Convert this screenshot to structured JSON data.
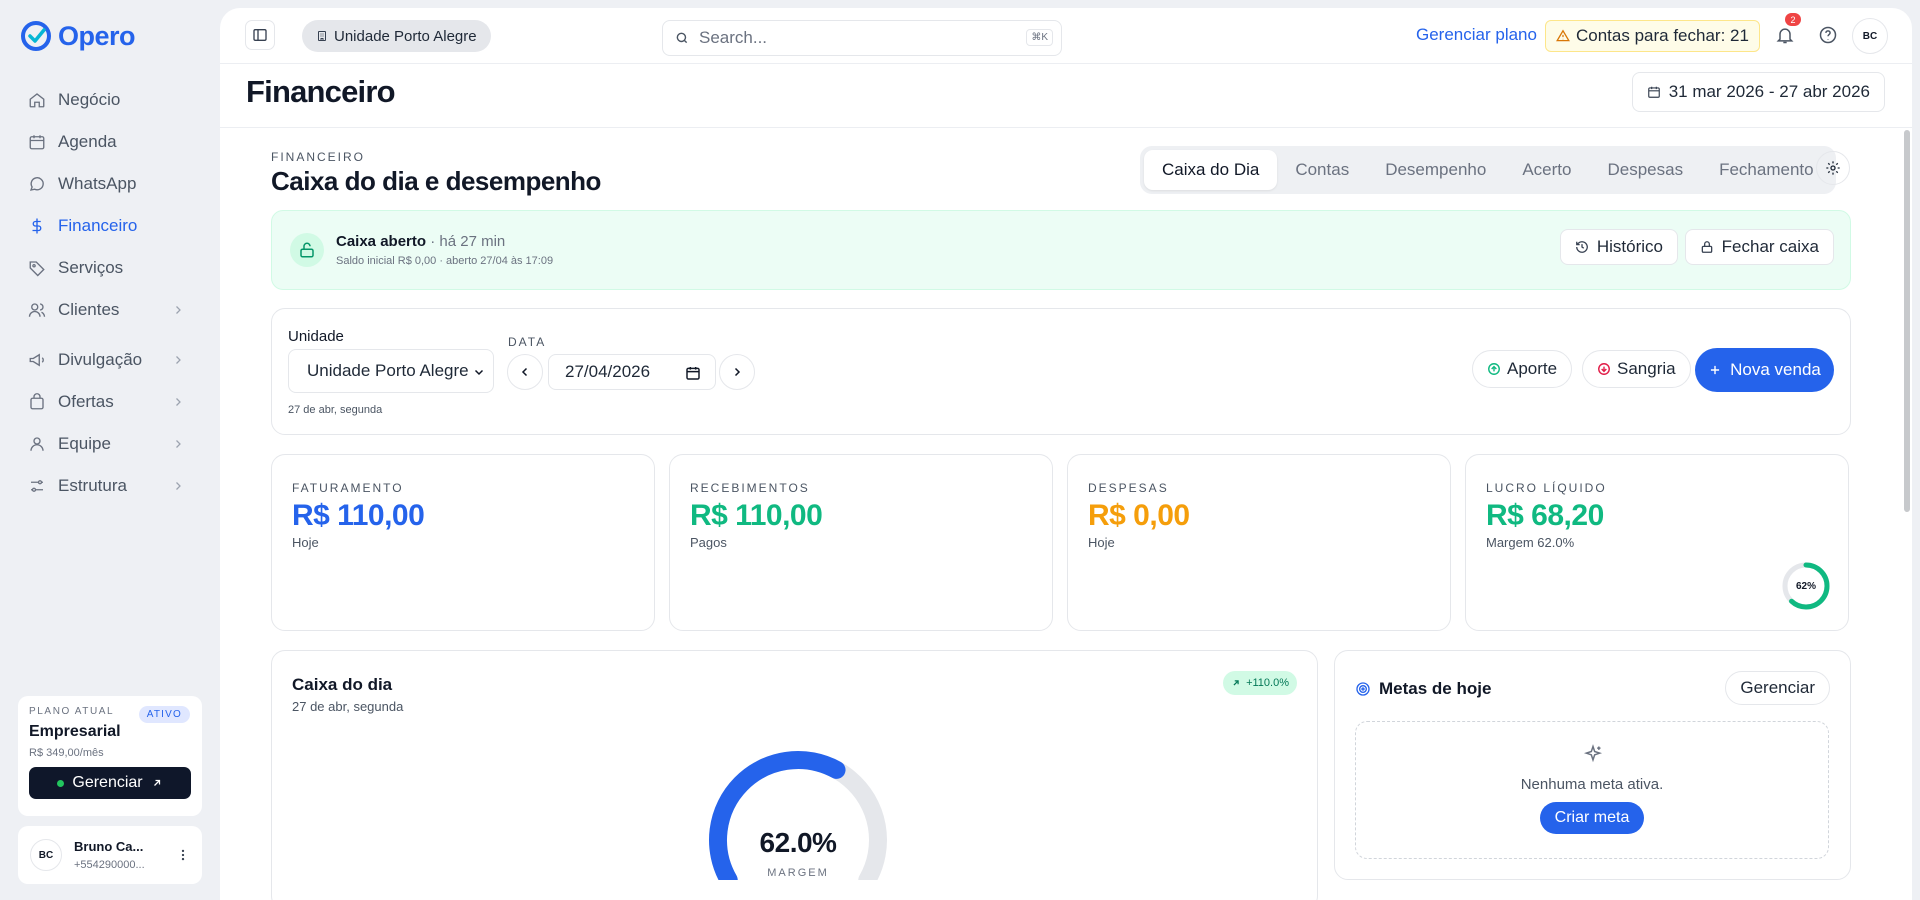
{
  "brand": {
    "name": "Opero",
    "color": "#2563eb"
  },
  "sidebar": {
    "items": [
      {
        "label": "Negócio",
        "icon": "home-icon"
      },
      {
        "label": "Agenda",
        "icon": "calendar-icon"
      },
      {
        "label": "WhatsApp",
        "icon": "chat-icon"
      },
      {
        "label": "Financeiro",
        "icon": "dollar-icon",
        "active": true
      },
      {
        "label": "Serviços",
        "icon": "tag-icon"
      },
      {
        "label": "Clientes",
        "icon": "users-icon"
      },
      {
        "label": "Divulgação",
        "icon": "megaphone-icon"
      },
      {
        "label": "Ofertas",
        "icon": "bag-icon"
      },
      {
        "label": "Equipe",
        "icon": "team-icon"
      },
      {
        "label": "Estrutura",
        "icon": "sliders-icon"
      }
    ],
    "plan": {
      "label": "PLANO ATUAL",
      "badge": "ATIVO",
      "name": "Empresarial",
      "price": "R$ 349,00/mês",
      "button": "Gerenciar"
    },
    "user": {
      "initials": "BC",
      "name": "Bruno Ca...",
      "phone": "+554290000..."
    }
  },
  "topbar": {
    "unit": "Unidade Porto Alegre",
    "search_placeholder": "Search...",
    "search_shortcut": "⌘K",
    "manage_plan": "Gerenciar plano",
    "alert": "Contas para fechar: 21",
    "notifications_count": "2",
    "avatar_initials": "BC"
  },
  "page": {
    "title": "Financeiro",
    "date_range": "31 mar 2026 - 27 abr 2026"
  },
  "section": {
    "eyebrow": "FINANCEIRO",
    "title": "Caixa do dia e desempenho",
    "tabs": [
      "Caixa do Dia",
      "Contas",
      "Desempenho",
      "Acerto",
      "Despesas",
      "Fechamento"
    ],
    "active_tab": "Caixa do Dia"
  },
  "cash": {
    "status": "Caixa aberto",
    "since": "· há 27 min",
    "detail": "Saldo inicial R$ 0,00 · aberto 27/04 às 17:09",
    "history_btn": "Histórico",
    "close_btn": "Fechar caixa"
  },
  "filters": {
    "unit_label": "Unidade",
    "unit_value": "Unidade Porto Alegre",
    "day_hint": "27 de abr, segunda",
    "date_label": "DATA",
    "date_value": "27/04/2026",
    "aporte": "Aporte",
    "sangria": "Sangria",
    "new_sale": "Nova venda"
  },
  "kpis": [
    {
      "label": "FATURAMENTO",
      "value": "R$ 110,00",
      "sub": "Hoje",
      "color": "#2563eb"
    },
    {
      "label": "RECEBIMENTOS",
      "value": "R$ 110,00",
      "sub": "Pagos",
      "color": "#10b981"
    },
    {
      "label": "DESPESAS",
      "value": "R$ 0,00",
      "sub": "Hoje",
      "color": "#f59e0b"
    },
    {
      "label": "LUCRO LÍQUIDO",
      "value": "R$ 68,20",
      "sub": "Margem 62.0%",
      "color": "#10b981",
      "ring_label": "62%",
      "ring_fraction": 0.62
    }
  ],
  "day": {
    "title": "Caixa do dia",
    "subtitle": "27 de abr, segunda",
    "trend": "+110.0%",
    "gauge_value": "62.0%",
    "gauge_fraction": 0.62,
    "gauge_label": "MARGEM"
  },
  "goals": {
    "title": "Metas de hoje",
    "manage_btn": "Gerenciar",
    "empty_text": "Nenhuma meta ativa.",
    "create_btn": "Criar meta"
  }
}
